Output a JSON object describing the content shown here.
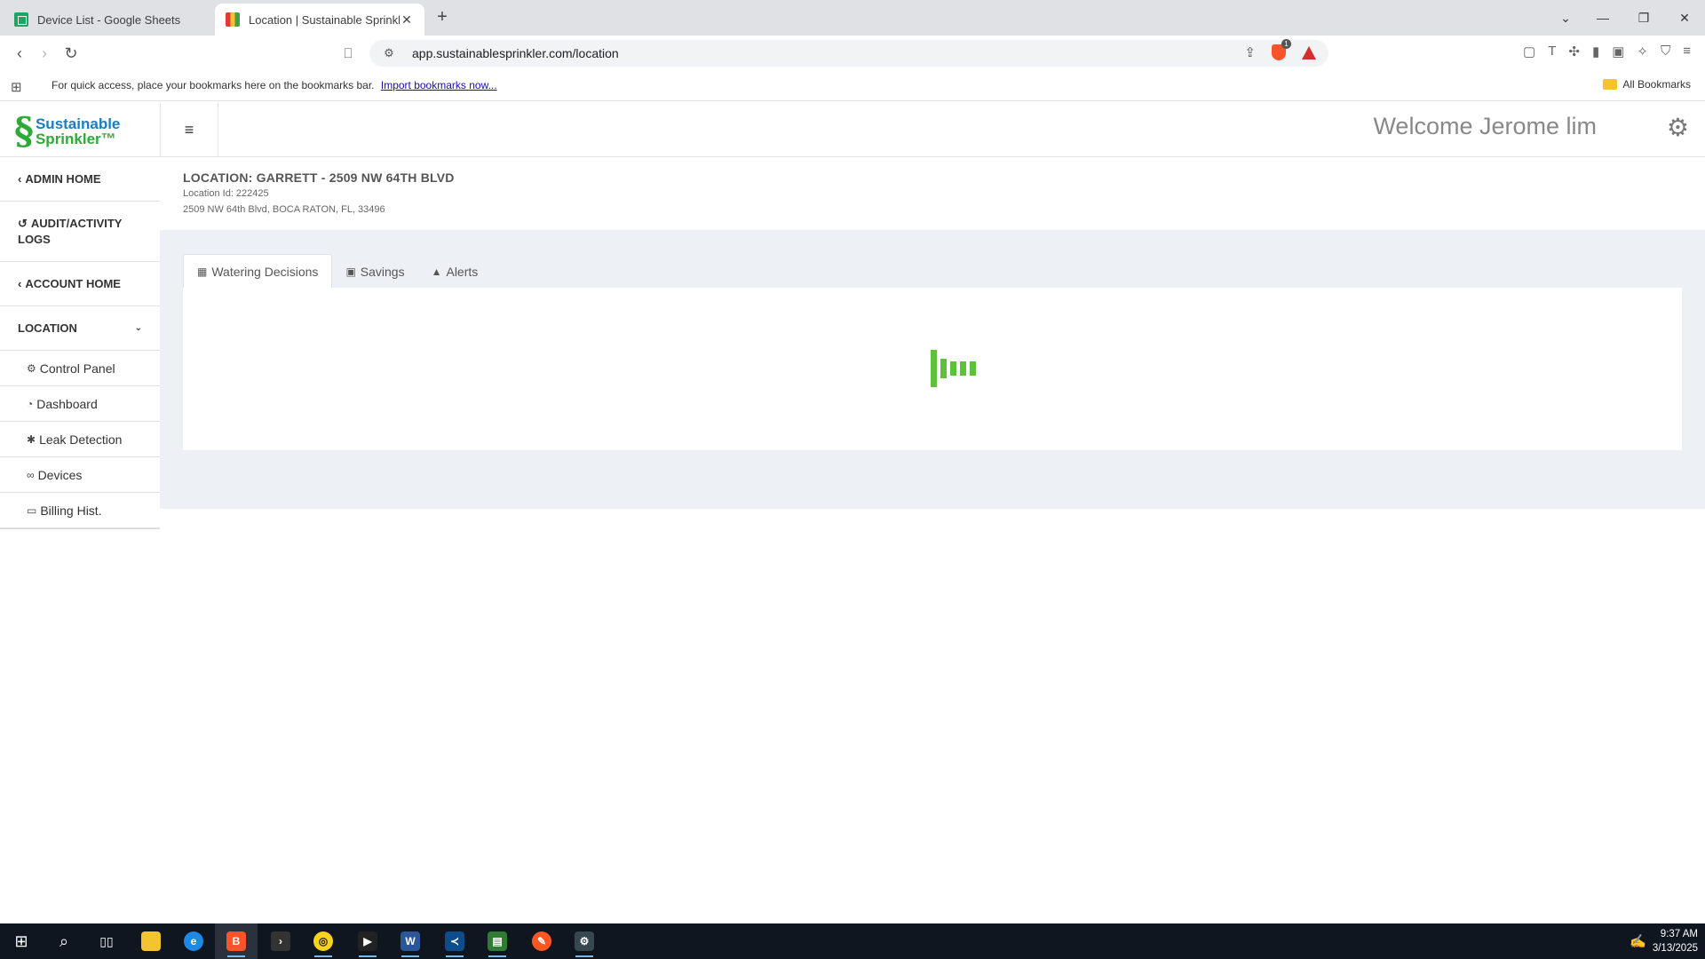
{
  "browser": {
    "tabs": [
      {
        "title": "Device List - Google Sheets"
      },
      {
        "title": "Location | Sustainable Sprinkler"
      }
    ],
    "url": "app.sustainablesprinkler.com/location",
    "bookmarks_message": "For quick access, place your bookmarks here on the bookmarks bar.",
    "import_link": "Import bookmarks now...",
    "all_bookmarks": "All Bookmarks",
    "shield_count": "1"
  },
  "app": {
    "logo": {
      "line1": "Sustainable",
      "line2": "Sprinkler™"
    },
    "welcome": "Welcome Jerome lim",
    "sidebar": {
      "admin_home": "ADMIN HOME",
      "audit_logs": "AUDIT/ACTIVITY LOGS",
      "account_home": "ACCOUNT HOME",
      "location": "LOCATION",
      "subitems": [
        {
          "label": "Control Panel",
          "icon": "cogs-icon"
        },
        {
          "label": "Dashboard",
          "icon": "dashboard-icon"
        },
        {
          "label": "Leak Detection",
          "icon": "asterisk-icon"
        },
        {
          "label": "Devices",
          "icon": "chain-icon"
        },
        {
          "label": "Billing Hist.",
          "icon": "money-icon"
        }
      ]
    },
    "location": {
      "title": "LOCATION: GARRETT - 2509 NW 64TH BLVD",
      "id_line": "Location Id: 222425",
      "address": "2509 NW 64th Blvd, BOCA RATON, FL, 33496"
    },
    "tabs": [
      {
        "label": "Watering Decisions",
        "active": true
      },
      {
        "label": "Savings",
        "active": false
      },
      {
        "label": "Alerts",
        "active": false
      }
    ],
    "accent_color": "#5fc13a"
  },
  "taskbar": {
    "time": "9:37 AM",
    "date": "3/13/2025"
  }
}
